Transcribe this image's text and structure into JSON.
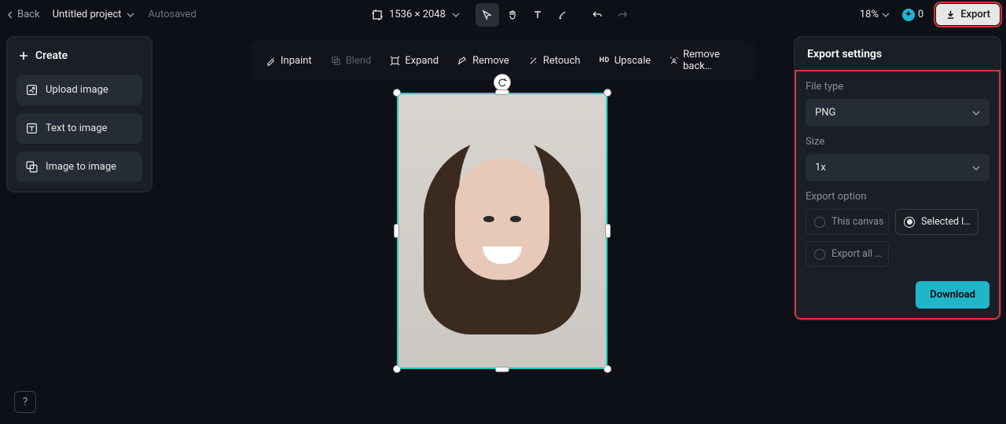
{
  "topbar": {
    "back": "Back",
    "title": "Untitled project",
    "autosave": "Autosaved",
    "dimensions": "1536 × 2048",
    "zoom": "18%",
    "credits": "0",
    "export": "Export"
  },
  "sidebar": {
    "create": "Create",
    "items": [
      {
        "label": "Upload image"
      },
      {
        "label": "Text to image"
      },
      {
        "label": "Image to image"
      }
    ]
  },
  "tools": [
    {
      "label": "Inpaint"
    },
    {
      "label": "Blend"
    },
    {
      "label": "Expand"
    },
    {
      "label": "Remove"
    },
    {
      "label": "Retouch"
    },
    {
      "label": "Upscale"
    },
    {
      "label": "Remove back…"
    }
  ],
  "panel": {
    "title": "Export settings",
    "filetype_label": "File type",
    "filetype_value": "PNG",
    "size_label": "Size",
    "size_value": "1x",
    "option_label": "Export option",
    "options": [
      {
        "label": "This canvas"
      },
      {
        "label": "Selected l…"
      },
      {
        "label": "Export all …"
      }
    ],
    "download": "Download"
  }
}
